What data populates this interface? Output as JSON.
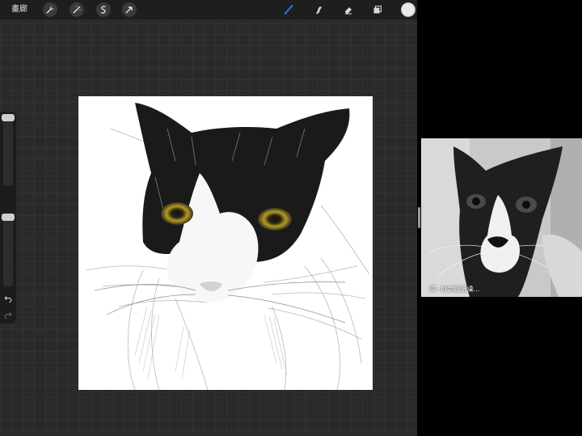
{
  "toolbar": {
    "gallery_label": "畫廊",
    "actions_icon": "wrench-icon",
    "adjustments_icon": "magic-wand-icon",
    "selection_icon": "selection-s-icon",
    "transform_icon": "arrow-cursor-icon",
    "brush_icon": "paintbrush-icon",
    "smudge_icon": "smudge-finger-icon",
    "eraser_icon": "eraser-icon",
    "layers_icon": "layers-icon",
    "current_color": "#e8e8e8",
    "accent_color": "#2f7bff"
  },
  "sidebar": {
    "undo_icon": "undo-icon",
    "redo_icon": "redo-icon"
  },
  "reference": {
    "caption": "哎~好討厭洗澡..."
  }
}
